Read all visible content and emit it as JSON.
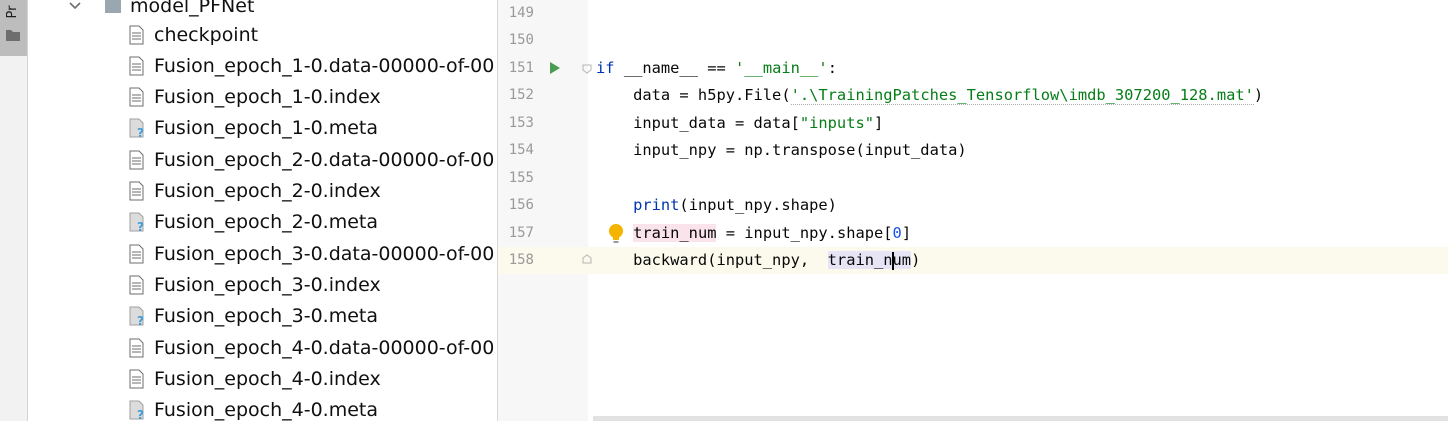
{
  "toolstrip": {
    "project_label": "Pr"
  },
  "tree": {
    "folder": "model_PFNet",
    "files": [
      {
        "name": "checkpoint",
        "icon": "text-file-icon"
      },
      {
        "name": "Fusion_epoch_1-0.data-00000-of-00",
        "icon": "text-file-icon"
      },
      {
        "name": "Fusion_epoch_1-0.index",
        "icon": "text-file-icon"
      },
      {
        "name": "Fusion_epoch_1-0.meta",
        "icon": "unknown-file-icon"
      },
      {
        "name": "Fusion_epoch_2-0.data-00000-of-00",
        "icon": "text-file-icon"
      },
      {
        "name": "Fusion_epoch_2-0.index",
        "icon": "text-file-icon"
      },
      {
        "name": "Fusion_epoch_2-0.meta",
        "icon": "unknown-file-icon"
      },
      {
        "name": "Fusion_epoch_3-0.data-00000-of-00",
        "icon": "text-file-icon"
      },
      {
        "name": "Fusion_epoch_3-0.index",
        "icon": "text-file-icon"
      },
      {
        "name": "Fusion_epoch_3-0.meta",
        "icon": "unknown-file-icon"
      },
      {
        "name": "Fusion_epoch_4-0.data-00000-of-00",
        "icon": "text-file-icon"
      },
      {
        "name": "Fusion_epoch_4-0.index",
        "icon": "text-file-icon"
      },
      {
        "name": "Fusion_epoch_4-0.meta",
        "icon": "unknown-file-icon"
      }
    ]
  },
  "editor": {
    "line_numbers": [
      "149",
      "150",
      "151",
      "152",
      "153",
      "154",
      "155",
      "156",
      "157",
      "158"
    ],
    "code": {
      "l151_if": "if",
      "l151_rest": " __name__ == ",
      "l151_str": "'__main__'",
      "l151_colon": ":",
      "l152_a": "    data = h5py.File(",
      "l152_str": "'.\\TrainingPatches_Tensorflow\\imdb_307200_128.mat'",
      "l152_b": ")",
      "l153_a": "    input_data = data[",
      "l153_str": "\"inputs\"",
      "l153_b": "]",
      "l154": "    input_npy = np.transpose(input_data)",
      "l156_print": "print",
      "l156_rest": "(input_npy.shape)",
      "l157_var": "train_num",
      "l157_a": " = input_npy.shape[",
      "l157_num": "0",
      "l157_b": "]",
      "l158_a": "    backward(input_npy,  ",
      "l158_ref1": "train_n",
      "l158_ref2": "um",
      "l158_b": ")"
    }
  },
  "colors": {
    "keyword": "#0033b3",
    "string": "#067d17",
    "number": "#1750eb",
    "caret_line": "#fcfaed",
    "warning_highlight": "#fbe3ec",
    "reference_highlight": "#e6e4f5",
    "run_green": "#499c54",
    "bulb_yellow": "#f4b400"
  }
}
